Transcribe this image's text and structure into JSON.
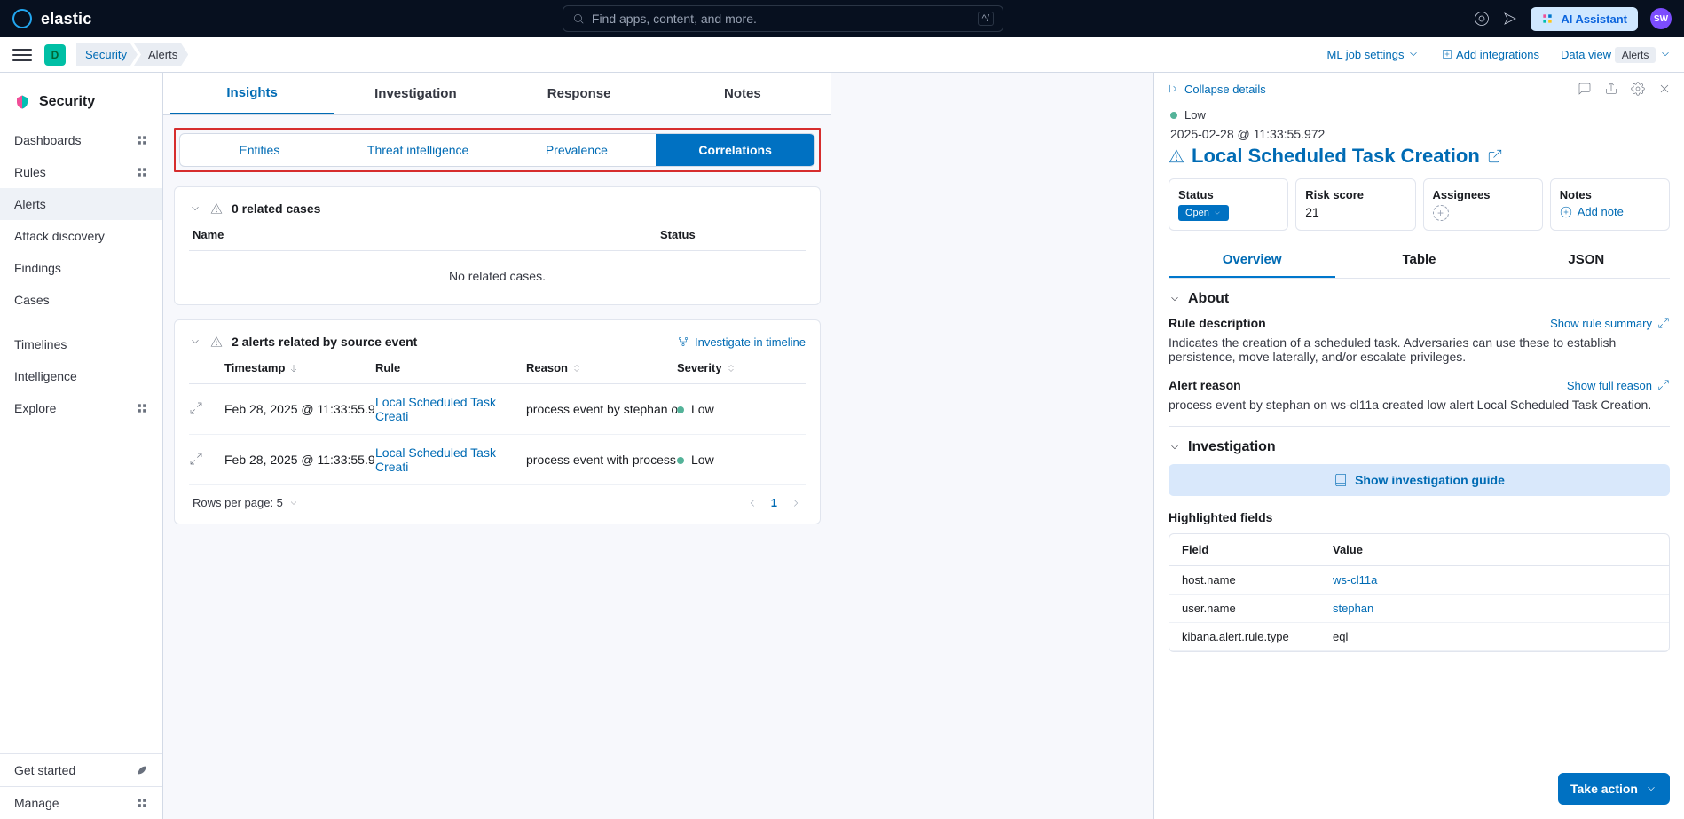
{
  "topbar": {
    "brand": "elastic",
    "search_placeholder": "Find apps, content, and more.",
    "ai_assistant": "AI Assistant",
    "avatar_initials": "SW"
  },
  "subbar": {
    "space_letter": "D",
    "crumb1": "Security",
    "crumb2": "Alerts",
    "ml_job": "ML job settings",
    "add_integrations": "Add integrations",
    "data_view": "Data view",
    "data_view_badge": "Alerts"
  },
  "sidenav": {
    "title": "Security",
    "items": [
      "Dashboards",
      "Rules",
      "Alerts",
      "Attack discovery",
      "Findings",
      "Cases"
    ],
    "active_index": 2,
    "items2": [
      "Timelines",
      "Intelligence",
      "Explore"
    ],
    "get_started": "Get started",
    "manage": "Manage"
  },
  "mid": {
    "tabs": [
      "Insights",
      "Investigation",
      "Response",
      "Notes"
    ],
    "active_tab_index": 0,
    "subtabs": [
      "Entities",
      "Threat intelligence",
      "Prevalence",
      "Correlations"
    ],
    "active_subtab_index": 3,
    "related_cases": {
      "head": "0 related cases",
      "cols": [
        "Name",
        "Status"
      ],
      "empty_msg": "No related cases."
    },
    "source_alerts": {
      "head": "2 alerts related by source event",
      "investigate_link": "Investigate in timeline",
      "cols": [
        "Timestamp",
        "Rule",
        "Reason",
        "Severity"
      ],
      "rows": [
        {
          "ts": "Feb 28, 2025 @ 11:33:55.9",
          "rule": "Local Scheduled Task Creati",
          "reason": "process event by stephan on",
          "sev": "Low"
        },
        {
          "ts": "Feb 28, 2025 @ 11:33:55.9",
          "rule": "Local Scheduled Task Creati",
          "reason": "process event with process p",
          "sev": "Low"
        }
      ],
      "rows_per_page_label": "Rows per page: 5",
      "page": "1"
    }
  },
  "flyout": {
    "collapse": "Collapse details",
    "severity": "Low",
    "timestamp": "2025-02-28 @ 11:33:55.972",
    "title": "Local Scheduled Task Creation",
    "meta": {
      "status_lbl": "Status",
      "status_val": "Open",
      "risk_lbl": "Risk score",
      "risk_val": "21",
      "assignees_lbl": "Assignees",
      "notes_lbl": "Notes",
      "add_note": "Add note"
    },
    "tabs": [
      "Overview",
      "Table",
      "JSON"
    ],
    "active_tab_index": 0,
    "about": {
      "title": "About",
      "rule_desc_lbl": "Rule description",
      "show_rule_summary": "Show rule summary",
      "rule_desc": "Indicates the creation of a scheduled task. Adversaries can use these to establish persistence, move laterally, and/or escalate privileges.",
      "alert_reason_lbl": "Alert reason",
      "show_full_reason": "Show full reason",
      "alert_reason": "process event by stephan on ws-cl11a created low alert Local Scheduled Task Creation."
    },
    "investigation": {
      "title": "Investigation",
      "btn": "Show investigation guide",
      "hf_title": "Highlighted fields",
      "hf_cols": [
        "Field",
        "Value"
      ],
      "hf_rows": [
        {
          "f": "host.name",
          "v": "ws-cl11a",
          "link": true
        },
        {
          "f": "user.name",
          "v": "stephan",
          "link": true
        },
        {
          "f": "kibana.alert.rule.type",
          "v": "eql",
          "link": false
        }
      ]
    },
    "take_action": "Take action"
  }
}
